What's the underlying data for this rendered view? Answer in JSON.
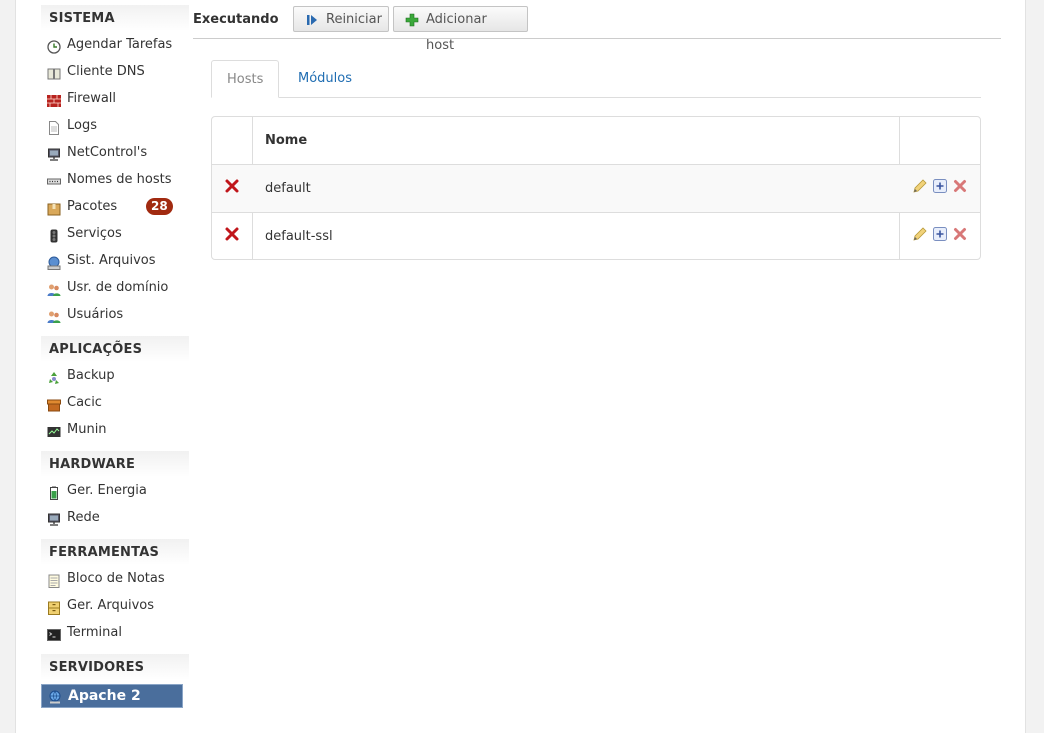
{
  "sidebar": {
    "sections": [
      {
        "title": "SISTEMA",
        "items": [
          {
            "label": "Agendar Tarefas",
            "icon": "clock-icon"
          },
          {
            "label": "Cliente DNS",
            "icon": "book-icon"
          },
          {
            "label": "Firewall",
            "icon": "brick-wall-icon"
          },
          {
            "label": "Logs",
            "icon": "document-icon"
          },
          {
            "label": "NetControl's",
            "icon": "network-computer-icon"
          },
          {
            "label": "Nomes de hosts",
            "icon": "network-icon"
          },
          {
            "label": "Pacotes",
            "icon": "package-icon",
            "badge": "28"
          },
          {
            "label": "Serviços",
            "icon": "traffic-light-icon"
          },
          {
            "label": "Sist. Arquivos",
            "icon": "drive-icon"
          },
          {
            "label": "Usr. de domínio",
            "icon": "users-icon"
          },
          {
            "label": "Usuários",
            "icon": "users-icon"
          }
        ]
      },
      {
        "title": "APLICAÇÕES",
        "items": [
          {
            "label": "Backup",
            "icon": "recycle-icon"
          },
          {
            "label": "Cacic",
            "icon": "box-icon"
          },
          {
            "label": "Munin",
            "icon": "monitor-graph-icon"
          }
        ]
      },
      {
        "title": "HARDWARE",
        "items": [
          {
            "label": "Ger. Energia",
            "icon": "battery-icon"
          },
          {
            "label": "Rede",
            "icon": "network-computer-icon"
          }
        ]
      },
      {
        "title": "FERRAMENTAS",
        "items": [
          {
            "label": "Bloco de Notas",
            "icon": "notepad-icon"
          },
          {
            "label": "Ger. Arquivos",
            "icon": "file-cabinet-icon"
          },
          {
            "label": "Terminal",
            "icon": "terminal-icon"
          }
        ]
      },
      {
        "title": "SERVIDORES",
        "items": [
          {
            "label": "Apache 2",
            "icon": "globe-server-icon",
            "active": true
          }
        ]
      }
    ]
  },
  "toolbar": {
    "status": "Executando",
    "restart_label": "Reiniciar",
    "add_host_label": "Adicionar host"
  },
  "tabs": [
    {
      "label": "Hosts",
      "active": true
    },
    {
      "label": "Módulos",
      "active": false
    }
  ],
  "table": {
    "header_name": "Nome",
    "rows": [
      {
        "name": "default"
      },
      {
        "name": "default-ssl"
      }
    ]
  },
  "colors": {
    "badge": "#a12a10",
    "link": "#1f6db2",
    "active_item": "#4a6e9c",
    "delete": "#c0161b"
  }
}
